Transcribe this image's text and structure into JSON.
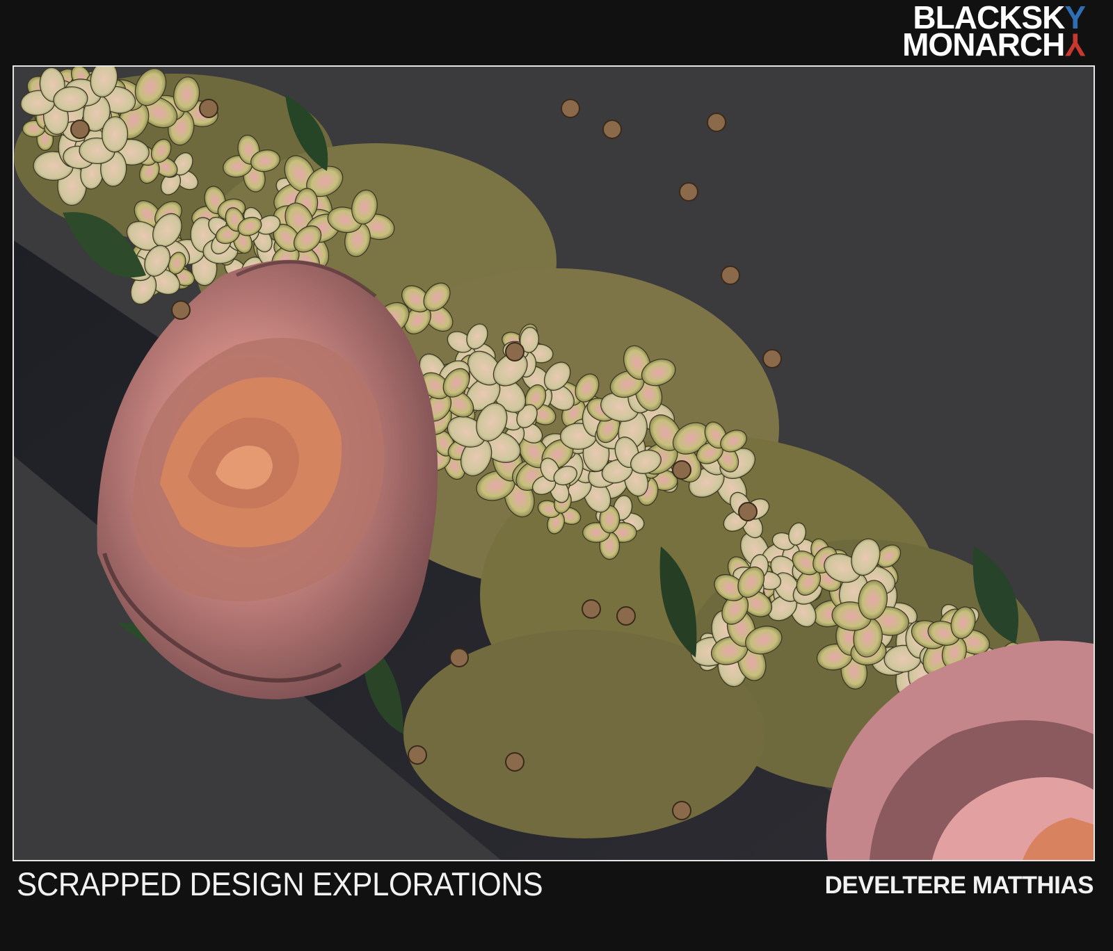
{
  "logo": {
    "line1_text": "BLACKSK",
    "line1_accent": "Y",
    "line2_text": "MONARCH",
    "line2_accent": "Y",
    "accent_blue": "#2f6db5",
    "accent_red": "#c8382e"
  },
  "artwork": {
    "subject_icon": "flower-bouquet-render",
    "background_color": "#3b3b3d",
    "palette": [
      "#d99a9a",
      "#c9c58a",
      "#a9a15a",
      "#e8b7b0",
      "#2f4a2a",
      "#8a6a4a"
    ]
  },
  "footer": {
    "title": "SCRAPPED DESIGN EXPLORATIONS",
    "author": "DEVELTERE MATTHIAS"
  }
}
